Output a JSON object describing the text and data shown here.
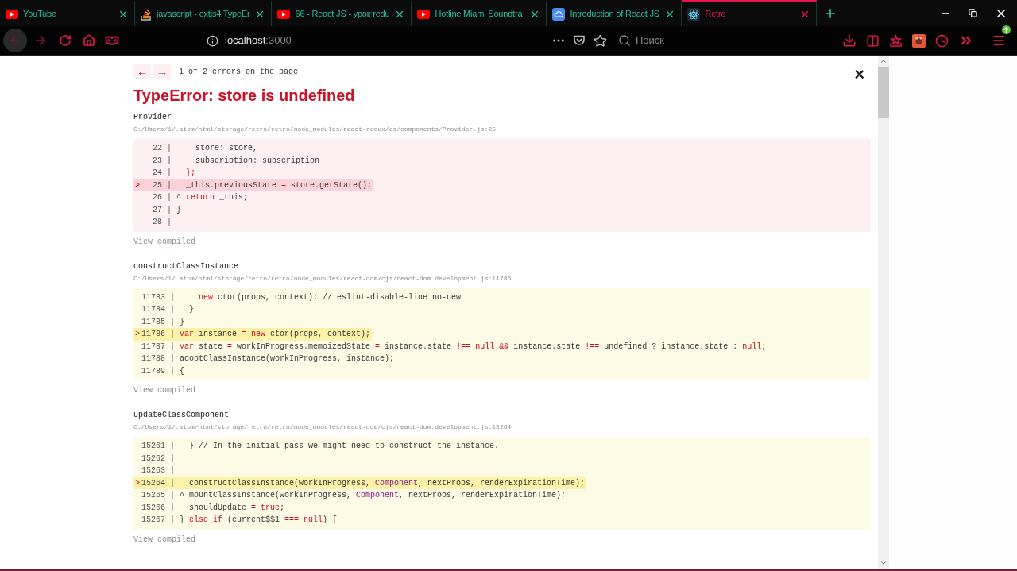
{
  "browser": {
    "tabs": [
      {
        "title": "YouTube",
        "kind": "youtube",
        "selected": false
      },
      {
        "title": "javascript - extjs4 TypeEr",
        "kind": "stack",
        "selected": false
      },
      {
        "title": "66 - React JS - урок redu",
        "kind": "youtube",
        "selected": false
      },
      {
        "title": "Hotline Miami Soundtra",
        "kind": "youtube",
        "selected": false
      },
      {
        "title": "Introduction of React JS",
        "kind": "cloud",
        "selected": false
      },
      {
        "title": "Retro",
        "kind": "react",
        "selected": true
      }
    ],
    "address": {
      "host": "localhost",
      "port": ":3000"
    },
    "search": {
      "placeholder": "Поиск"
    }
  },
  "overlay": {
    "prev": "←",
    "next": "→",
    "counter": "1 of 2 errors on the page",
    "close": "×",
    "title": "TypeError: store is undefined",
    "frames": [
      {
        "name": "Provider",
        "path": "C:/Users/1/.atom/html/storage/retro/retro/node_modules/react-redux/es/components/Provider.js:25",
        "kind": "error",
        "footer": "View compiled",
        "lines": [
          {
            "gutter": "22 |",
            "highlighted": false,
            "tokens": [
              {
                "text": "    store: store,",
                "kind": "plain"
              }
            ]
          },
          {
            "gutter": "23 |",
            "highlighted": false,
            "tokens": [
              {
                "text": "    subscription: subscription",
                "kind": "plain"
              }
            ]
          },
          {
            "gutter": "24 |",
            "highlighted": false,
            "tokens": [
              {
                "text": "  };",
                "kind": "punct"
              }
            ]
          },
          {
            "gutter": "25 |",
            "highlighted": true,
            "pointer": ">",
            "tokens": [
              {
                "text": "  _this.previousState ",
                "kind": "plain"
              },
              {
                "text": "=",
                "kind": "punct"
              },
              {
                "text": " store.getState();",
                "kind": "plain"
              }
            ]
          },
          {
            "gutter": "26 |",
            "highlighted": false,
            "tokens": [
              {
                "text": "^ ",
                "kind": "plain"
              },
              {
                "text": "return",
                "kind": "keyword"
              },
              {
                "text": " _this;",
                "kind": "plain"
              }
            ]
          },
          {
            "gutter": "27 |",
            "highlighted": false,
            "tokens": [
              {
                "text": "}",
                "kind": "plain"
              }
            ]
          },
          {
            "gutter": "28 |",
            "highlighted": false
          }
        ]
      },
      {
        "name": "constructClassInstance",
        "path": "C:/Users/1/.atom/html/storage/retro/retro/node_modules/react-dom/cjs/react-dom.development.js:11786",
        "kind": "warning",
        "footer": "View compiled",
        "lines": [
          {
            "gutter": "11783 |",
            "highlighted": false,
            "tokens": [
              {
                "text": "    new",
                "kind": "keyword"
              },
              {
                "text": " ctor(props, context); // eslint-disable-line no-new",
                "kind": "plain"
              }
            ]
          },
          {
            "gutter": "11784 |",
            "highlighted": false,
            "tokens": [
              {
                "text": "  }",
                "kind": "plain"
              }
            ]
          },
          {
            "gutter": "11785 |",
            "highlighted": false,
            "tokens": [
              {
                "text": "}",
                "kind": "plain"
              }
            ]
          },
          {
            "gutter": "11786 |",
            "highlighted": true,
            "pointer": ">",
            "tokens": [
              {
                "text": "var",
                "kind": "keyword"
              },
              {
                "text": " instance ",
                "kind": "plain"
              },
              {
                "text": "= ",
                "kind": "punct"
              },
              {
                "text": "new",
                "kind": "keyword"
              },
              {
                "text": " ctor(props, context);",
                "kind": "plain"
              }
            ]
          },
          {
            "gutter": "11787 |",
            "highlighted": false,
            "tokens": [
              {
                "text": "var",
                "kind": "keyword"
              },
              {
                "text": " state ",
                "kind": "plain"
              },
              {
                "text": "=",
                "kind": "punct"
              },
              {
                "text": " workInProgress.memoizedState ",
                "kind": "plain"
              },
              {
                "text": "=",
                "kind": "punct"
              },
              {
                "text": " instance.state ",
                "kind": "plain"
              },
              {
                "text": "!== ",
                "kind": "punct"
              },
              {
                "text": "null ",
                "kind": "keyword"
              },
              {
                "text": "&&",
                "kind": "punct"
              },
              {
                "text": " instance.state ",
                "kind": "plain"
              },
              {
                "text": "!==",
                "kind": "punct"
              },
              {
                "text": " undefined ? instance.state : ",
                "kind": "plain"
              },
              {
                "text": "null",
                "kind": "keyword"
              },
              {
                "text": ";",
                "kind": "plain"
              }
            ]
          },
          {
            "gutter": "11788 |",
            "highlighted": false,
            "tokens": [
              {
                "text": "adoptClassInstance(workInProgress, instance);",
                "kind": "plain"
              }
            ]
          },
          {
            "gutter": "11789 |",
            "highlighted": false,
            "tokens": [
              {
                "text": "{",
                "kind": "plain"
              }
            ]
          }
        ]
      },
      {
        "name": "updateClassComponent",
        "path": "C:/Users/1/.atom/html/storage/retro/retro/node_modules/react-dom/cjs/react-dom.development.js:15264",
        "kind": "warning",
        "footer": "View compiled",
        "lines": [
          {
            "gutter": "15261 |",
            "highlighted": false,
            "tokens": [
              {
                "text": "  } // In the initial pass we might need to construct the instance.",
                "kind": "plain"
              }
            ]
          },
          {
            "gutter": "15262 |",
            "highlighted": false
          },
          {
            "gutter": "15263 |",
            "highlighted": false
          },
          {
            "gutter": "15264 |",
            "highlighted": true,
            "pointer": ">",
            "tokens": [
              {
                "text": "  constructClassInstance(workInProgress, ",
                "kind": "plain"
              },
              {
                "text": "Component",
                "kind": "name"
              },
              {
                "text": ", nextProps, renderExpirationTime);",
                "kind": "plain"
              }
            ]
          },
          {
            "gutter": "15265 |",
            "highlighted": false,
            "tokens": [
              {
                "text": "^ mountClassInstance(workInProgress, ",
                "kind": "plain"
              },
              {
                "text": "Component",
                "kind": "name"
              },
              {
                "text": ", nextProps, renderExpirationTime);",
                "kind": "plain"
              }
            ]
          },
          {
            "gutter": "15266 |",
            "highlighted": false,
            "tokens": [
              {
                "text": "  shouldUpdate ",
                "kind": "plain"
              },
              {
                "text": "= ",
                "kind": "punct"
              },
              {
                "text": "true",
                "kind": "keyword"
              },
              {
                "text": ";",
                "kind": "plain"
              }
            ]
          },
          {
            "gutter": "15267 |",
            "highlighted": false,
            "tokens": [
              {
                "text": "} ",
                "kind": "plain"
              },
              {
                "text": "else if",
                "kind": "keyword"
              },
              {
                "text": " (current$$1 ",
                "kind": "plain"
              },
              {
                "text": "=== ",
                "kind": "punct"
              },
              {
                "text": "null",
                "kind": "keyword"
              },
              {
                "text": ") {",
                "kind": "plain"
              }
            ]
          }
        ]
      }
    ]
  }
}
